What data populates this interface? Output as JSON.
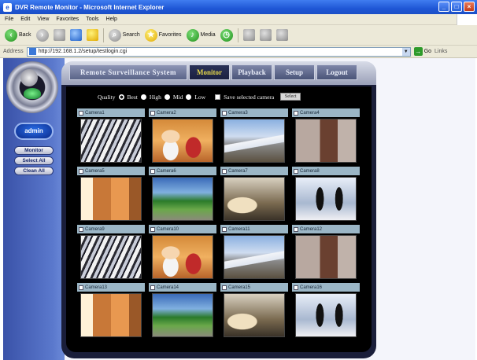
{
  "browser": {
    "title": "DVR Remote Monitor - Microsoft Internet Explorer",
    "menu": [
      "File",
      "Edit",
      "View",
      "Favorites",
      "Tools",
      "Help"
    ],
    "toolbar": {
      "back": "Back",
      "search": "Search",
      "favorites": "Favorites",
      "media": "Media"
    },
    "address_label": "Address",
    "address_value": "http://192.168.1.2/setup/testlogin.cgi",
    "go_label": "Go",
    "links_label": "Links"
  },
  "app": {
    "user": "admin",
    "side_buttons": [
      "Monitor",
      "Select All",
      "Clean All"
    ],
    "tabs": {
      "title": "Remote Surveillance System",
      "items": [
        "Monitor",
        "Playback",
        "Setup",
        "Logout"
      ],
      "active": "Monitor"
    },
    "quality": {
      "label": "Quality",
      "options": [
        "Best",
        "High",
        "Mid",
        "Low"
      ],
      "selected": "Best",
      "save_label": "Save selected camera",
      "button": "Select"
    },
    "cameras": [
      {
        "label": "Camera1",
        "scene": "crowd"
      },
      {
        "label": "Camera2",
        "scene": "office"
      },
      {
        "label": "Camera3",
        "scene": "train"
      },
      {
        "label": "Camera4",
        "scene": "door"
      },
      {
        "label": "Camera5",
        "scene": "hall"
      },
      {
        "label": "Camera6",
        "scene": "park"
      },
      {
        "label": "Camera7",
        "scene": "car"
      },
      {
        "label": "Camera8",
        "scene": "people"
      },
      {
        "label": "Camera9",
        "scene": "crowd"
      },
      {
        "label": "Camera10",
        "scene": "office"
      },
      {
        "label": "Camera11",
        "scene": "train"
      },
      {
        "label": "Camera12",
        "scene": "door"
      },
      {
        "label": "Camera13",
        "scene": "hall"
      },
      {
        "label": "Camera14",
        "scene": "park"
      },
      {
        "label": "Camera15",
        "scene": "car"
      },
      {
        "label": "Camera16",
        "scene": "people"
      }
    ]
  }
}
